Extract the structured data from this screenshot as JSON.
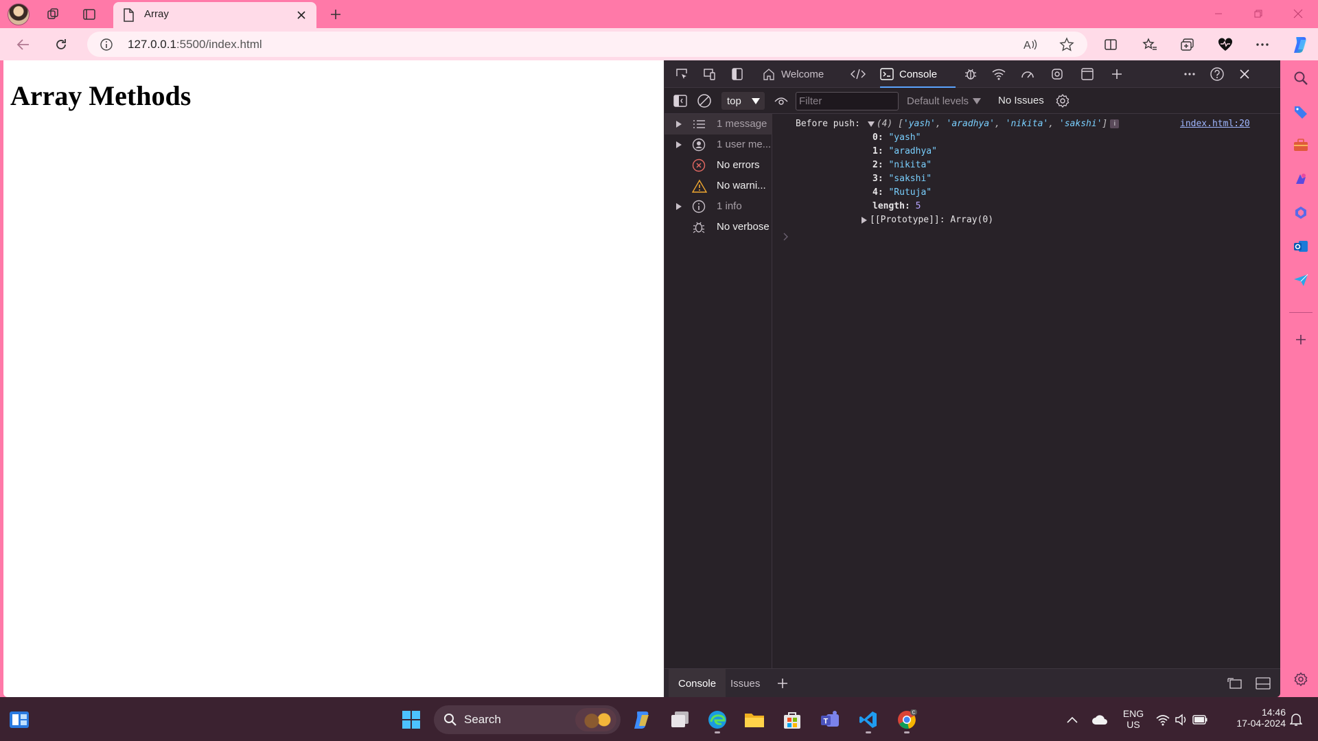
{
  "browser": {
    "tab_title": "Array",
    "url_host": "127.0.0.1",
    "url_path": ":5500/index.html"
  },
  "page": {
    "heading": "Array Methods"
  },
  "devtools": {
    "tabs": [
      {
        "label": "Welcome",
        "active": false
      },
      {
        "label": "Console",
        "active": true
      }
    ],
    "console_bar": {
      "context": "top",
      "filter_placeholder": "Filter",
      "levels": "Default levels",
      "issues": "No Issues"
    },
    "sidebar": [
      {
        "label": "1 message",
        "selected": true
      },
      {
        "label": "1 user me...",
        "selected": false
      },
      {
        "label": "No errors",
        "selected": false
      },
      {
        "label": "No warni...",
        "selected": false
      },
      {
        "label": "1 info",
        "selected": false
      },
      {
        "label": "No verbose",
        "selected": false
      }
    ],
    "console": {
      "prefix": "Before push:",
      "summary_count": "(4)",
      "summary_items": [
        "'yash'",
        "'aradhya'",
        "'nikita'",
        "'sakshi'"
      ],
      "source": "index.html:20",
      "entries": [
        {
          "key": "0",
          "value": "\"yash\""
        },
        {
          "key": "1",
          "value": "\"aradhya\""
        },
        {
          "key": "2",
          "value": "\"nikita\""
        },
        {
          "key": "3",
          "value": "\"sakshi\""
        },
        {
          "key": "4",
          "value": "\"Rutuja\""
        }
      ],
      "length_key": "length",
      "length_value": "5",
      "prototype_key": "[[Prototype]]",
      "prototype_value": "Array(0)"
    },
    "drawer_tabs": [
      "Console",
      "Issues"
    ]
  },
  "taskbar": {
    "search_label": "Search",
    "lang_line1": "ENG",
    "lang_line2": "US",
    "time": "14:46",
    "date": "17-04-2024"
  },
  "colors": {
    "chrome_pink": "#ff79a8",
    "toolbar_pink": "#ffdbe8",
    "devtools_bg": "#282228",
    "accent_blue": "#5ba4ff"
  }
}
